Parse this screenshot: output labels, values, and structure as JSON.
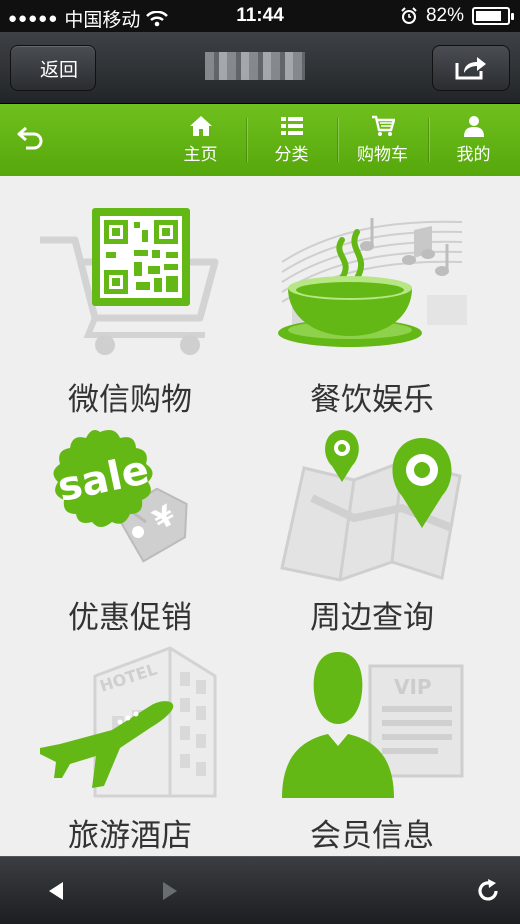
{
  "status": {
    "carrier": "中国移动",
    "time": "11:44",
    "battery": "82%",
    "battery_level": 0.82
  },
  "navbar": {
    "back_label": "返回",
    "title_blurred": true
  },
  "greenbar": {
    "items": [
      {
        "label": "主页",
        "icon": "home-icon"
      },
      {
        "label": "分类",
        "icon": "list-icon"
      },
      {
        "label": "购物车",
        "icon": "cart-icon"
      },
      {
        "label": "我的",
        "icon": "user-icon"
      }
    ]
  },
  "tiles": [
    {
      "label": "微信购物",
      "icon": "qr-cart-icon"
    },
    {
      "label": "餐饮娱乐",
      "icon": "tea-music-icon"
    },
    {
      "label": "优惠促销",
      "icon": "sale-tag-icon"
    },
    {
      "label": "周边查询",
      "icon": "map-pin-icon"
    },
    {
      "label": "旅游酒店",
      "icon": "plane-hotel-icon"
    },
    {
      "label": "会员信息",
      "icon": "vip-member-icon"
    }
  ],
  "colors": {
    "accent": "#62b515",
    "toolbar": "#2a2d30"
  }
}
